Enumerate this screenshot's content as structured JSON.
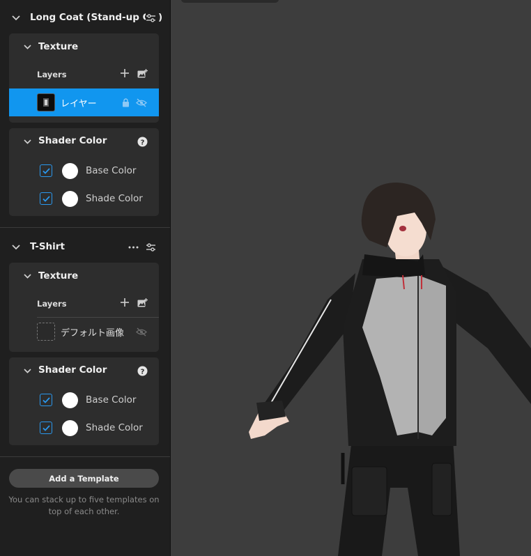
{
  "groups": [
    {
      "title": "Long Coat (Stand-up Co",
      "title_suffix": ")",
      "texture_title": "Texture",
      "layers_label": "Layers",
      "layer_name": "レイヤー",
      "shader_title": "Shader Color",
      "base_label": "Base Color",
      "shade_label": "Shade Color"
    },
    {
      "title": "T-Shirt",
      "texture_title": "Texture",
      "layers_label": "Layers",
      "layer_name": "デフォルト画像",
      "shader_title": "Shader Color",
      "base_label": "Base Color",
      "shade_label": "Shade Color"
    }
  ],
  "add_template_label": "Add a Template",
  "hint_text": "You can stack up to five templates on top of each other.",
  "colors": {
    "accent": "#1196ef",
    "sidebar_bg": "#1f1f1f",
    "card_bg": "#2d2d2d",
    "viewport_bg": "#3d3d3d"
  }
}
